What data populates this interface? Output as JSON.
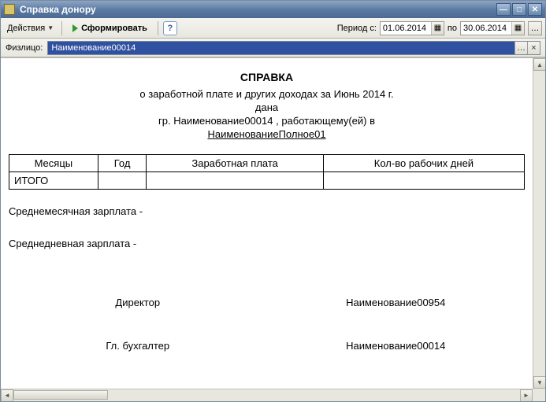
{
  "window": {
    "title": "Справка донору"
  },
  "toolbar": {
    "actions_label": "Действия",
    "run_label": "Сформировать",
    "period_label": "Период с:",
    "period_to": "по",
    "date_from": "01.06.2014",
    "date_to": "30.06.2014"
  },
  "filter": {
    "label": "Физлицо:",
    "value": "Наименование00014"
  },
  "doc": {
    "title": "СПРАВКА",
    "subtitle": "о заработной плате и других доходах  за Июнь 2014 г.",
    "given": "дана",
    "to_line": "гр. Наименование00014  , работающему(ей) в",
    "org": "НаименованиеПолное01",
    "headers": [
      "Месяцы",
      "Год",
      "Заработная  плата",
      "Кол-во рабочих дней"
    ],
    "total_label": "ИТОГО",
    "avg_month": "Среднемесячная зарплата -",
    "avg_day": "Среднедневная зарплата -",
    "sig1_role": "Директор",
    "sig1_name": "Наименование00954",
    "sig2_role": "Гл. бухгалтер",
    "sig2_name": "Наименование00014"
  }
}
